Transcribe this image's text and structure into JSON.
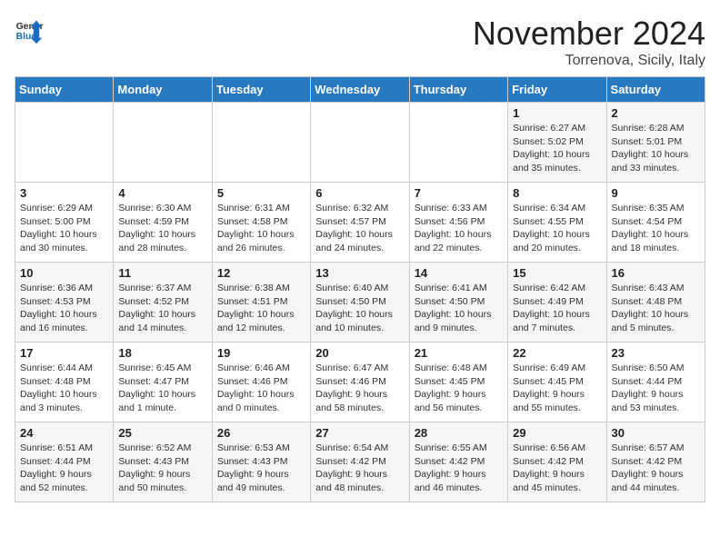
{
  "logo": {
    "line1": "General",
    "line2": "Blue"
  },
  "title": "November 2024",
  "subtitle": "Torrenova, Sicily, Italy",
  "days_of_week": [
    "Sunday",
    "Monday",
    "Tuesday",
    "Wednesday",
    "Thursday",
    "Friday",
    "Saturday"
  ],
  "weeks": [
    [
      {
        "day": "",
        "info": ""
      },
      {
        "day": "",
        "info": ""
      },
      {
        "day": "",
        "info": ""
      },
      {
        "day": "",
        "info": ""
      },
      {
        "day": "",
        "info": ""
      },
      {
        "day": "1",
        "info": "Sunrise: 6:27 AM\nSunset: 5:02 PM\nDaylight: 10 hours and 35 minutes."
      },
      {
        "day": "2",
        "info": "Sunrise: 6:28 AM\nSunset: 5:01 PM\nDaylight: 10 hours and 33 minutes."
      }
    ],
    [
      {
        "day": "3",
        "info": "Sunrise: 6:29 AM\nSunset: 5:00 PM\nDaylight: 10 hours and 30 minutes."
      },
      {
        "day": "4",
        "info": "Sunrise: 6:30 AM\nSunset: 4:59 PM\nDaylight: 10 hours and 28 minutes."
      },
      {
        "day": "5",
        "info": "Sunrise: 6:31 AM\nSunset: 4:58 PM\nDaylight: 10 hours and 26 minutes."
      },
      {
        "day": "6",
        "info": "Sunrise: 6:32 AM\nSunset: 4:57 PM\nDaylight: 10 hours and 24 minutes."
      },
      {
        "day": "7",
        "info": "Sunrise: 6:33 AM\nSunset: 4:56 PM\nDaylight: 10 hours and 22 minutes."
      },
      {
        "day": "8",
        "info": "Sunrise: 6:34 AM\nSunset: 4:55 PM\nDaylight: 10 hours and 20 minutes."
      },
      {
        "day": "9",
        "info": "Sunrise: 6:35 AM\nSunset: 4:54 PM\nDaylight: 10 hours and 18 minutes."
      }
    ],
    [
      {
        "day": "10",
        "info": "Sunrise: 6:36 AM\nSunset: 4:53 PM\nDaylight: 10 hours and 16 minutes."
      },
      {
        "day": "11",
        "info": "Sunrise: 6:37 AM\nSunset: 4:52 PM\nDaylight: 10 hours and 14 minutes."
      },
      {
        "day": "12",
        "info": "Sunrise: 6:38 AM\nSunset: 4:51 PM\nDaylight: 10 hours and 12 minutes."
      },
      {
        "day": "13",
        "info": "Sunrise: 6:40 AM\nSunset: 4:50 PM\nDaylight: 10 hours and 10 minutes."
      },
      {
        "day": "14",
        "info": "Sunrise: 6:41 AM\nSunset: 4:50 PM\nDaylight: 10 hours and 9 minutes."
      },
      {
        "day": "15",
        "info": "Sunrise: 6:42 AM\nSunset: 4:49 PM\nDaylight: 10 hours and 7 minutes."
      },
      {
        "day": "16",
        "info": "Sunrise: 6:43 AM\nSunset: 4:48 PM\nDaylight: 10 hours and 5 minutes."
      }
    ],
    [
      {
        "day": "17",
        "info": "Sunrise: 6:44 AM\nSunset: 4:48 PM\nDaylight: 10 hours and 3 minutes."
      },
      {
        "day": "18",
        "info": "Sunrise: 6:45 AM\nSunset: 4:47 PM\nDaylight: 10 hours and 1 minute."
      },
      {
        "day": "19",
        "info": "Sunrise: 6:46 AM\nSunset: 4:46 PM\nDaylight: 10 hours and 0 minutes."
      },
      {
        "day": "20",
        "info": "Sunrise: 6:47 AM\nSunset: 4:46 PM\nDaylight: 9 hours and 58 minutes."
      },
      {
        "day": "21",
        "info": "Sunrise: 6:48 AM\nSunset: 4:45 PM\nDaylight: 9 hours and 56 minutes."
      },
      {
        "day": "22",
        "info": "Sunrise: 6:49 AM\nSunset: 4:45 PM\nDaylight: 9 hours and 55 minutes."
      },
      {
        "day": "23",
        "info": "Sunrise: 6:50 AM\nSunset: 4:44 PM\nDaylight: 9 hours and 53 minutes."
      }
    ],
    [
      {
        "day": "24",
        "info": "Sunrise: 6:51 AM\nSunset: 4:44 PM\nDaylight: 9 hours and 52 minutes."
      },
      {
        "day": "25",
        "info": "Sunrise: 6:52 AM\nSunset: 4:43 PM\nDaylight: 9 hours and 50 minutes."
      },
      {
        "day": "26",
        "info": "Sunrise: 6:53 AM\nSunset: 4:43 PM\nDaylight: 9 hours and 49 minutes."
      },
      {
        "day": "27",
        "info": "Sunrise: 6:54 AM\nSunset: 4:42 PM\nDaylight: 9 hours and 48 minutes."
      },
      {
        "day": "28",
        "info": "Sunrise: 6:55 AM\nSunset: 4:42 PM\nDaylight: 9 hours and 46 minutes."
      },
      {
        "day": "29",
        "info": "Sunrise: 6:56 AM\nSunset: 4:42 PM\nDaylight: 9 hours and 45 minutes."
      },
      {
        "day": "30",
        "info": "Sunrise: 6:57 AM\nSunset: 4:42 PM\nDaylight: 9 hours and 44 minutes."
      }
    ]
  ]
}
